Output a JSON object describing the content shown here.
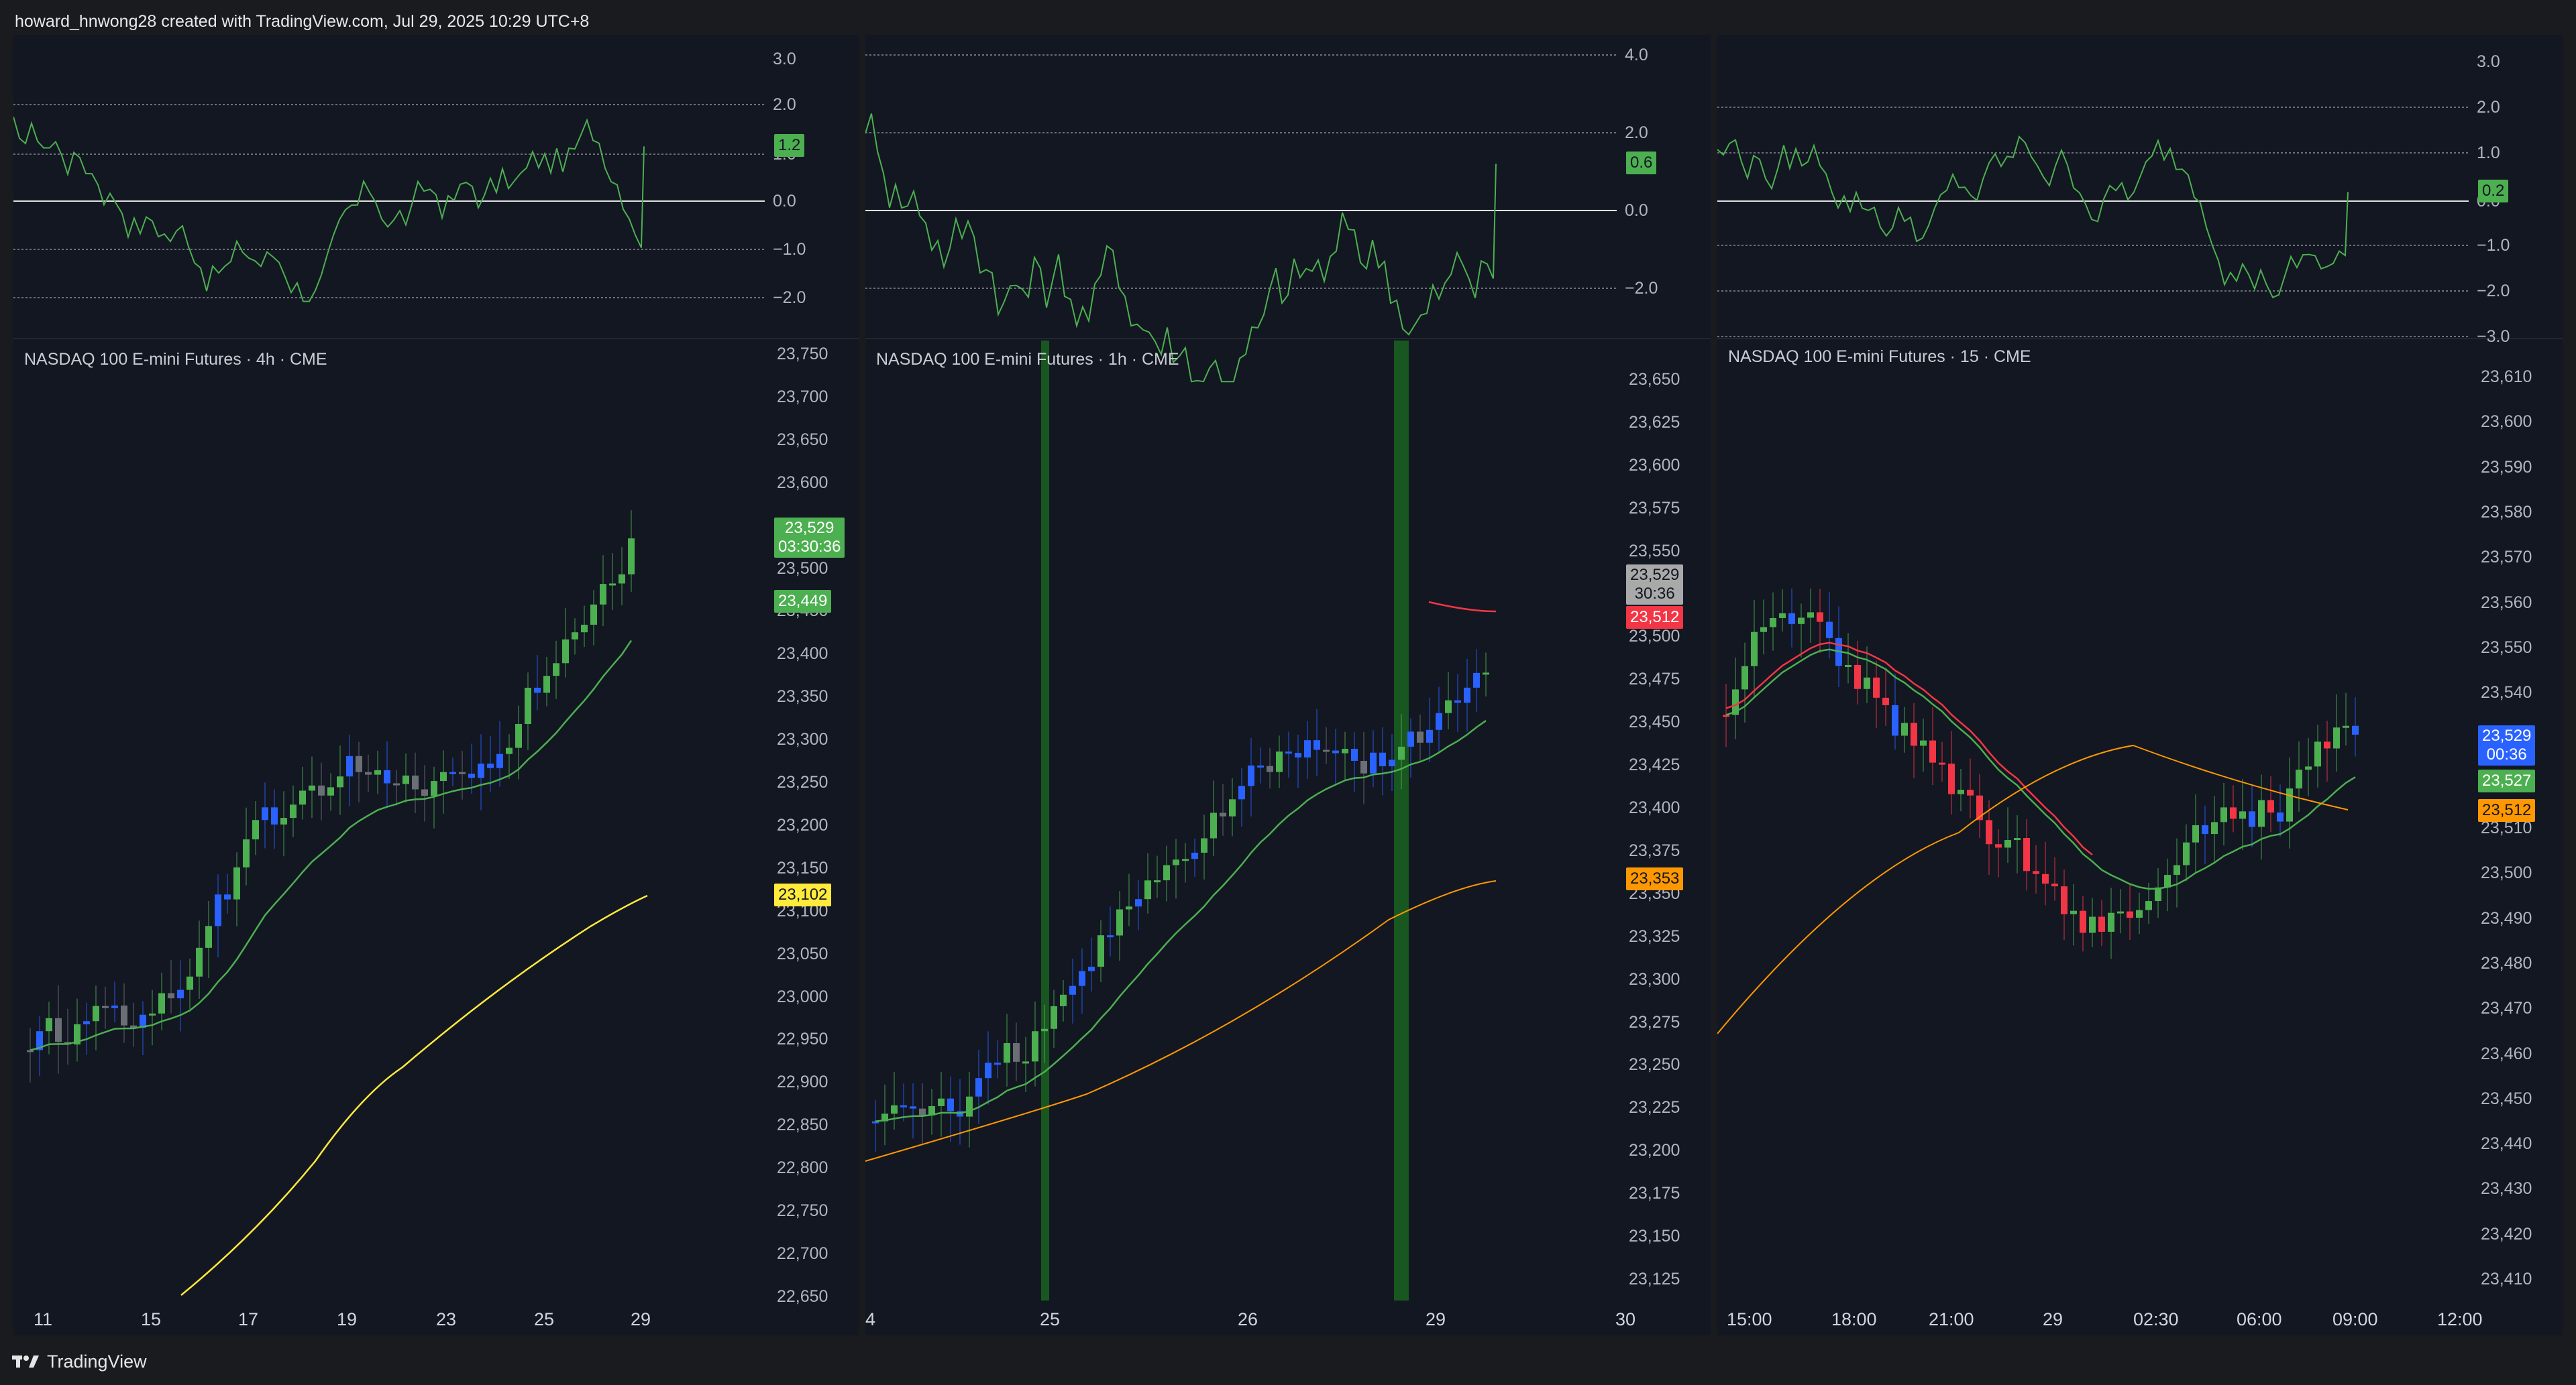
{
  "header": {
    "text": "howard_hnwong28 created with TradingView.com, Jul 29, 2025 10:29 UTC+8"
  },
  "footer": {
    "brand": "TradingView"
  },
  "colors": {
    "background": "#131722",
    "up_green": "#4caf50",
    "up_blue": "#2962ff",
    "down_red": "#f23645",
    "neutral_gray": "#6b6e75",
    "oscillator_line": "#4caf50",
    "ma_yellow": "#ffeb3b",
    "ma_orange": "#ff9800",
    "ma_red": "#f23645",
    "session_highlight": "#1b5e20"
  },
  "panels": [
    {
      "id": "4h",
      "title": "NASDAQ 100 E-mini Futures · 4h · CME",
      "oscillator": {
        "ticks": [
          "3.0",
          "2.0",
          "1.0",
          "0.0",
          "−1.0",
          "−2.0"
        ],
        "current": "1.2"
      },
      "price_axis": [
        "23,750",
        "23,700",
        "23,650",
        "23,600",
        "23,550",
        "23,500",
        "23,450",
        "23,400",
        "23,350",
        "23,300",
        "23,250",
        "23,200",
        "23,150",
        "23,100",
        "23,050",
        "23,000",
        "22,950",
        "22,900",
        "22,850",
        "22,800",
        "22,750",
        "22,700",
        "22,650"
      ],
      "time_axis": [
        "11",
        "15",
        "17",
        "19",
        "23",
        "25",
        "29"
      ],
      "badges": [
        {
          "line1": "23,529",
          "line2": "03:30:36",
          "color": "#4caf50"
        },
        {
          "line1": "23,449",
          "line2": "",
          "color": "#4caf50"
        },
        {
          "line1": "23,102",
          "line2": "",
          "color": "#ffeb3b"
        }
      ]
    },
    {
      "id": "1h",
      "title": "NASDAQ 100 E-mini Futures · 1h · CME",
      "oscillator": {
        "ticks": [
          "4.0",
          "2.0",
          "0.0",
          "−2.0"
        ],
        "current": "0.6"
      },
      "price_axis": [
        "23,650",
        "23,625",
        "23,600",
        "23,575",
        "23,550",
        "23,525",
        "23,500",
        "23,475",
        "23,450",
        "23,425",
        "23,400",
        "23,375",
        "23,350",
        "23,325",
        "23,300",
        "23,275",
        "23,250",
        "23,225",
        "23,200",
        "23,175",
        "23,150",
        "23,125"
      ],
      "time_axis": [
        "4",
        "25",
        "26",
        "29",
        "30"
      ],
      "badges": [
        {
          "line1": "23,529",
          "line2": "30:36",
          "color": "#a9a9a9"
        },
        {
          "line1": "23,512",
          "line2": "",
          "color": "#f23645"
        },
        {
          "line1": "23,353",
          "line2": "",
          "color": "#ff9800"
        }
      ]
    },
    {
      "id": "15",
      "title": "NASDAQ 100 E-mini Futures · 15 · CME",
      "oscillator": {
        "ticks": [
          "3.0",
          "2.0",
          "1.0",
          "0.0",
          "−1.0",
          "−2.0",
          "−3.0"
        ],
        "current": "0.2"
      },
      "price_axis": [
        "23,610",
        "23,600",
        "23,590",
        "23,580",
        "23,570",
        "23,560",
        "23,550",
        "23,540",
        "23,530",
        "23,520",
        "23,510",
        "23,500",
        "23,490",
        "23,480",
        "23,470",
        "23,460",
        "23,450",
        "23,440",
        "23,430",
        "23,420",
        "23,410"
      ],
      "time_axis": [
        "15:00",
        "18:00",
        "21:00",
        "29",
        "02:30",
        "06:00",
        "09:00",
        "12:00"
      ],
      "badges": [
        {
          "line1": "23,529",
          "line2": "00:36",
          "color": "#2962ff"
        },
        {
          "line1": "23,527",
          "line2": "",
          "color": "#4caf50"
        },
        {
          "line1": "23,512",
          "line2": "",
          "color": "#ff9800"
        }
      ]
    }
  ]
}
